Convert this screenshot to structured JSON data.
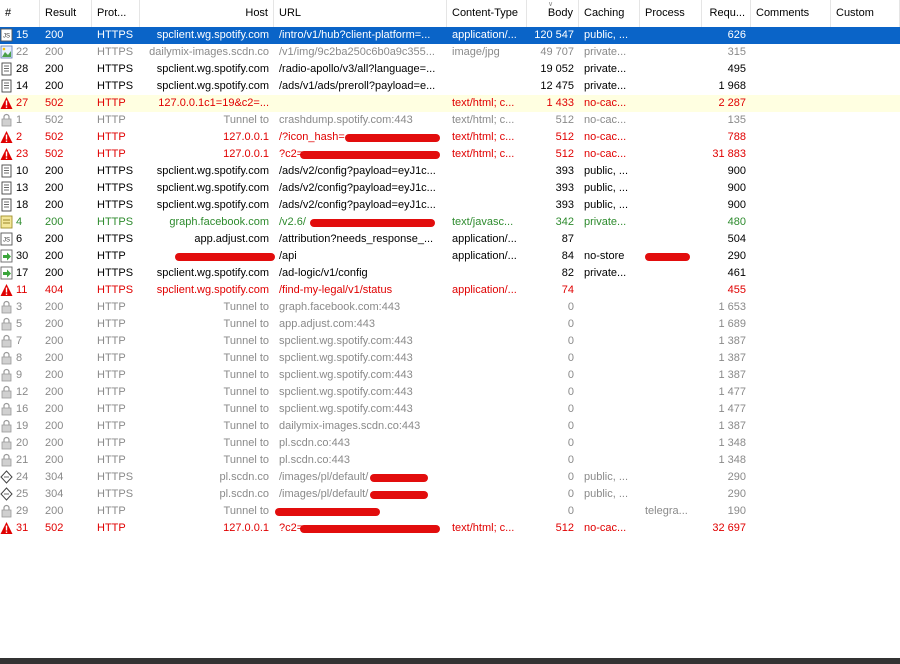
{
  "columns": [
    {
      "key": "num",
      "label": "#"
    },
    {
      "key": "result",
      "label": "Result"
    },
    {
      "key": "protocol",
      "label": "Prot..."
    },
    {
      "key": "host",
      "label": "Host"
    },
    {
      "key": "url",
      "label": "URL"
    },
    {
      "key": "ctype",
      "label": "Content-Type"
    },
    {
      "key": "body",
      "label": "Body"
    },
    {
      "key": "caching",
      "label": "Caching"
    },
    {
      "key": "process",
      "label": "Process"
    },
    {
      "key": "requ",
      "label": "Requ..."
    },
    {
      "key": "comments",
      "label": "Comments"
    },
    {
      "key": "custom",
      "label": "Custom"
    }
  ],
  "rows": [
    {
      "num": "15",
      "result": "200",
      "protocol": "HTTPS",
      "host": "spclient.wg.spotify.com",
      "url": "/intro/v1/hub?client-platform=...",
      "ctype": "application/...",
      "body": "120 547",
      "caching": "public, ...",
      "process": "",
      "requ": "626",
      "color": "black",
      "icon": "json-icon",
      "selected": true
    },
    {
      "num": "22",
      "result": "200",
      "protocol": "HTTPS",
      "host": "dailymix-images.scdn.co",
      "url": "/v1/img/9c2ba250c6b0a9c355...",
      "ctype": "image/jpg",
      "body": "49 707",
      "caching": "private...",
      "process": "",
      "requ": "315",
      "color": "gray",
      "icon": "image-icon"
    },
    {
      "num": "28",
      "result": "200",
      "protocol": "HTTPS",
      "host": "spclient.wg.spotify.com",
      "url": "/radio-apollo/v3/all?language=...",
      "ctype": "",
      "body": "19 052",
      "caching": "private...",
      "process": "",
      "requ": "495",
      "color": "black",
      "icon": "document-icon"
    },
    {
      "num": "14",
      "result": "200",
      "protocol": "HTTPS",
      "host": "spclient.wg.spotify.com",
      "url": "/ads/v1/ads/preroll?payload=e...",
      "ctype": "",
      "body": "12 475",
      "caching": "private...",
      "process": "",
      "requ": "1 968",
      "color": "black",
      "icon": "document-icon"
    },
    {
      "num": "27",
      "result": "502",
      "protocol": "HTTP",
      "host": "127.0.0.1c1=19&c2=...",
      "url": "",
      "ctype": "text/html; c...",
      "body": "1 433",
      "caching": "no-cac...",
      "process": "",
      "requ": "2 287",
      "color": "red",
      "icon": "warning-icon",
      "highlight": true
    },
    {
      "num": "1",
      "result": "502",
      "protocol": "HTTP",
      "host": "Tunnel to",
      "url": "crashdump.spotify.com:443",
      "ctype": "text/html; c...",
      "body": "512",
      "caching": "no-cac...",
      "process": "",
      "requ": "135",
      "color": "gray",
      "icon": "lock-icon"
    },
    {
      "num": "2",
      "result": "502",
      "protocol": "HTTP",
      "host": "127.0.0.1",
      "url": "/?icon_hash=",
      "ctype": "text/html; c...",
      "body": "512",
      "caching": "no-cac...",
      "process": "",
      "requ": "788",
      "color": "red",
      "icon": "warning-icon"
    },
    {
      "num": "23",
      "result": "502",
      "protocol": "HTTP",
      "host": "127.0.0.1",
      "url": "?c2=",
      "ctype": "text/html; c...",
      "body": "512",
      "caching": "no-cac...",
      "process": "",
      "requ": "31 883",
      "color": "red",
      "icon": "warning-icon"
    },
    {
      "num": "10",
      "result": "200",
      "protocol": "HTTPS",
      "host": "spclient.wg.spotify.com",
      "url": "/ads/v2/config?payload=eyJ1c...",
      "ctype": "",
      "body": "393",
      "caching": "public, ...",
      "process": "",
      "requ": "900",
      "color": "black",
      "icon": "document-icon"
    },
    {
      "num": "13",
      "result": "200",
      "protocol": "HTTPS",
      "host": "spclient.wg.spotify.com",
      "url": "/ads/v2/config?payload=eyJ1c...",
      "ctype": "",
      "body": "393",
      "caching": "public, ...",
      "process": "",
      "requ": "900",
      "color": "black",
      "icon": "document-icon"
    },
    {
      "num": "18",
      "result": "200",
      "protocol": "HTTPS",
      "host": "spclient.wg.spotify.com",
      "url": "/ads/v2/config?payload=eyJ1c...",
      "ctype": "",
      "body": "393",
      "caching": "public, ...",
      "process": "",
      "requ": "900",
      "color": "black",
      "icon": "document-icon"
    },
    {
      "num": "4",
      "result": "200",
      "protocol": "HTTPS",
      "host": "graph.facebook.com",
      "url": "/v2.6/",
      "ctype": "text/javasc...",
      "body": "342",
      "caching": "private...",
      "process": "",
      "requ": "480",
      "color": "green",
      "icon": "script-icon"
    },
    {
      "num": "6",
      "result": "200",
      "protocol": "HTTPS",
      "host": "app.adjust.com",
      "url": "/attribution?needs_response_...",
      "ctype": "application/...",
      "body": "87",
      "caching": "",
      "process": "",
      "requ": "504",
      "color": "black",
      "icon": "json-icon"
    },
    {
      "num": "30",
      "result": "200",
      "protocol": "HTTP",
      "host": "",
      "url": "/api",
      "ctype": "application/...",
      "body": "84",
      "caching": "no-store",
      "process": "",
      "requ": "290",
      "color": "black",
      "icon": "arrow-icon"
    },
    {
      "num": "17",
      "result": "200",
      "protocol": "HTTPS",
      "host": "spclient.wg.spotify.com",
      "url": "/ad-logic/v1/config",
      "ctype": "",
      "body": "82",
      "caching": "private...",
      "process": "",
      "requ": "461",
      "color": "black",
      "icon": "arrow-icon"
    },
    {
      "num": "11",
      "result": "404",
      "protocol": "HTTPS",
      "host": "spclient.wg.spotify.com",
      "url": "/find-my-legal/v1/status",
      "ctype": "application/...",
      "body": "74",
      "caching": "",
      "process": "",
      "requ": "455",
      "color": "red",
      "icon": "warning-icon"
    },
    {
      "num": "3",
      "result": "200",
      "protocol": "HTTP",
      "host": "Tunnel to",
      "url": "graph.facebook.com:443",
      "ctype": "",
      "body": "0",
      "caching": "",
      "process": "",
      "requ": "1 653",
      "color": "gray",
      "icon": "lock-icon"
    },
    {
      "num": "5",
      "result": "200",
      "protocol": "HTTP",
      "host": "Tunnel to",
      "url": "app.adjust.com:443",
      "ctype": "",
      "body": "0",
      "caching": "",
      "process": "",
      "requ": "1 689",
      "color": "gray",
      "icon": "lock-icon"
    },
    {
      "num": "7",
      "result": "200",
      "protocol": "HTTP",
      "host": "Tunnel to",
      "url": "spclient.wg.spotify.com:443",
      "ctype": "",
      "body": "0",
      "caching": "",
      "process": "",
      "requ": "1 387",
      "color": "gray",
      "icon": "lock-icon"
    },
    {
      "num": "8",
      "result": "200",
      "protocol": "HTTP",
      "host": "Tunnel to",
      "url": "spclient.wg.spotify.com:443",
      "ctype": "",
      "body": "0",
      "caching": "",
      "process": "",
      "requ": "1 387",
      "color": "gray",
      "icon": "lock-icon"
    },
    {
      "num": "9",
      "result": "200",
      "protocol": "HTTP",
      "host": "Tunnel to",
      "url": "spclient.wg.spotify.com:443",
      "ctype": "",
      "body": "0",
      "caching": "",
      "process": "",
      "requ": "1 387",
      "color": "gray",
      "icon": "lock-icon"
    },
    {
      "num": "12",
      "result": "200",
      "protocol": "HTTP",
      "host": "Tunnel to",
      "url": "spclient.wg.spotify.com:443",
      "ctype": "",
      "body": "0",
      "caching": "",
      "process": "",
      "requ": "1 477",
      "color": "gray",
      "icon": "lock-icon"
    },
    {
      "num": "16",
      "result": "200",
      "protocol": "HTTP",
      "host": "Tunnel to",
      "url": "spclient.wg.spotify.com:443",
      "ctype": "",
      "body": "0",
      "caching": "",
      "process": "",
      "requ": "1 477",
      "color": "gray",
      "icon": "lock-icon"
    },
    {
      "num": "19",
      "result": "200",
      "protocol": "HTTP",
      "host": "Tunnel to",
      "url": "dailymix-images.scdn.co:443",
      "ctype": "",
      "body": "0",
      "caching": "",
      "process": "",
      "requ": "1 387",
      "color": "gray",
      "icon": "lock-icon"
    },
    {
      "num": "20",
      "result": "200",
      "protocol": "HTTP",
      "host": "Tunnel to",
      "url": "pl.scdn.co:443",
      "ctype": "",
      "body": "0",
      "caching": "",
      "process": "",
      "requ": "1 348",
      "color": "gray",
      "icon": "lock-icon"
    },
    {
      "num": "21",
      "result": "200",
      "protocol": "HTTP",
      "host": "Tunnel to",
      "url": "pl.scdn.co:443",
      "ctype": "",
      "body": "0",
      "caching": "",
      "process": "",
      "requ": "1 348",
      "color": "gray",
      "icon": "lock-icon"
    },
    {
      "num": "24",
      "result": "304",
      "protocol": "HTTPS",
      "host": "pl.scdn.co",
      "url": "/images/pl/default/",
      "ctype": "",
      "body": "0",
      "caching": "public, ...",
      "process": "",
      "requ": "290",
      "color": "gray",
      "icon": "diamond-icon"
    },
    {
      "num": "25",
      "result": "304",
      "protocol": "HTTPS",
      "host": "pl.scdn.co",
      "url": "/images/pl/default/",
      "ctype": "",
      "body": "0",
      "caching": "public, ...",
      "process": "",
      "requ": "290",
      "color": "gray",
      "icon": "diamond-icon"
    },
    {
      "num": "29",
      "result": "200",
      "protocol": "HTTP",
      "host": "Tunnel to",
      "url": "",
      "ctype": "",
      "body": "0",
      "caching": "",
      "process": "telegra...",
      "requ": "190",
      "color": "gray",
      "icon": "lock-icon"
    },
    {
      "num": "31",
      "result": "502",
      "protocol": "HTTP",
      "host": "127.0.0.1",
      "url": "?c2=",
      "ctype": "text/html; c...",
      "body": "512",
      "caching": "no-cac...",
      "process": "",
      "requ": "32 697",
      "color": "red",
      "icon": "warning-icon"
    }
  ],
  "colors": {
    "selected": "#0a64c8",
    "highlight": "#ffffe1",
    "red": "#e00000",
    "gray": "#8a8a8a",
    "green": "#2e8b2e"
  }
}
